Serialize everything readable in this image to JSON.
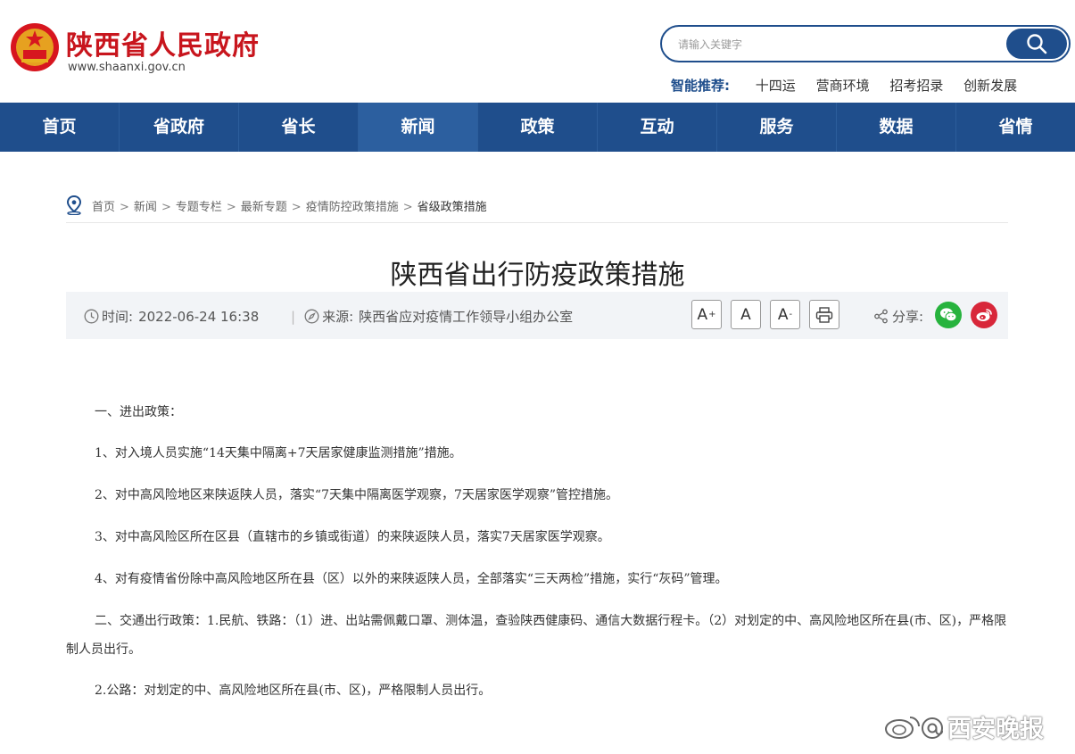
{
  "header": {
    "site_title": "陕西省人民政府",
    "site_url": "www.shaanxi.gov.cn",
    "search_placeholder": "请输入关键字",
    "recommend_label": "智能推荐:",
    "recommend_links": [
      "十四运",
      "营商环境",
      "招考招录",
      "创新发展"
    ]
  },
  "nav": {
    "items": [
      "首页",
      "省政府",
      "省长",
      "新闻",
      "政策",
      "互动",
      "服务",
      "数据",
      "省情"
    ],
    "active": "新闻"
  },
  "breadcrumb": {
    "items": [
      "首页",
      "新闻",
      "专题专栏",
      "最新专题",
      "疫情防控政策措施"
    ],
    "current": "省级政策措施",
    "separator": ">"
  },
  "article": {
    "title": "陕西省出行防疫政策措施",
    "time_label": "时间:",
    "time_value": "2022-06-24 16:38",
    "source_label": "来源:",
    "source_value": "陕西省应对疫情工作领导小组办公室",
    "font_increase": "A",
    "font_normal": "A",
    "font_decrease": "A",
    "share_label": "分享:",
    "paragraphs": [
      "一、进出政策：",
      "1、对入境人员实施“14天集中隔离+7天居家健康监测措施”措施。",
      "2、对中高风险地区来陕返陕人员，落实“7天集中隔离医学观察，7天居家医学观察”管控措施。",
      "3、对中高风险区所在区县（直辖市的乡镇或街道）的来陕返陕人员，落实7天居家医学观察。",
      "4、对有疫情省份除中高风险地区所在县（区）以外的来陕返陕人员，全部落实“三天两检”措施，实行“灰码”管理。",
      "二、交通出行政策：1.民航、铁路：（1）进、出站需佩戴口罩、测体温，查验陕西健康码、通信大数据行程卡。（2）对划定的中、高风险地区所在县(市、区)，严格限制人员出行。",
      "2.公路：对划定的中、高风险地区所在县(市、区)，严格限制人员出行。"
    ]
  },
  "watermark": "西安晚报",
  "colors": {
    "brand_red": "#c8151d",
    "nav_blue": "#1f4e8c",
    "wechat_green": "#27b33e",
    "weibo_red": "#d8273a"
  }
}
